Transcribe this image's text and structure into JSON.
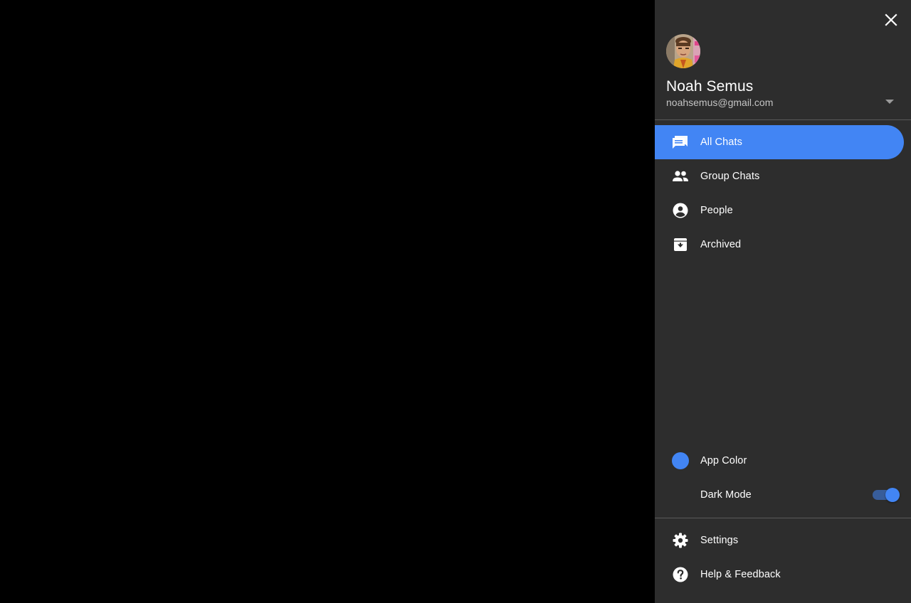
{
  "user": {
    "name": "Noah Semus",
    "email": "noahsemus@gmail.com"
  },
  "icons": {
    "close": "close-icon",
    "account_menu": "arrow-drop-down-icon",
    "avatar": "user-avatar-photo"
  },
  "nav": {
    "items": [
      {
        "label": "All Chats",
        "icon": "forum-icon",
        "active": true
      },
      {
        "label": "Group Chats",
        "icon": "group-icon",
        "active": false
      },
      {
        "label": "People",
        "icon": "account-circle-icon",
        "active": false
      },
      {
        "label": "Archived",
        "icon": "archive-icon",
        "active": false
      }
    ]
  },
  "preferences": {
    "app_color": {
      "label": "App Color",
      "icon": "color-dot",
      "value": "#4285f4"
    },
    "dark_mode": {
      "label": "Dark Mode",
      "icon": "moon-icon",
      "enabled": true
    }
  },
  "footer": {
    "items": [
      {
        "label": "Settings",
        "icon": "gear-icon"
      },
      {
        "label": "Help & Feedback",
        "icon": "help-icon"
      }
    ]
  },
  "colors": {
    "accent": "#4285f4",
    "drawer_bg": "#2d2d2d",
    "backdrop": "#000000"
  }
}
